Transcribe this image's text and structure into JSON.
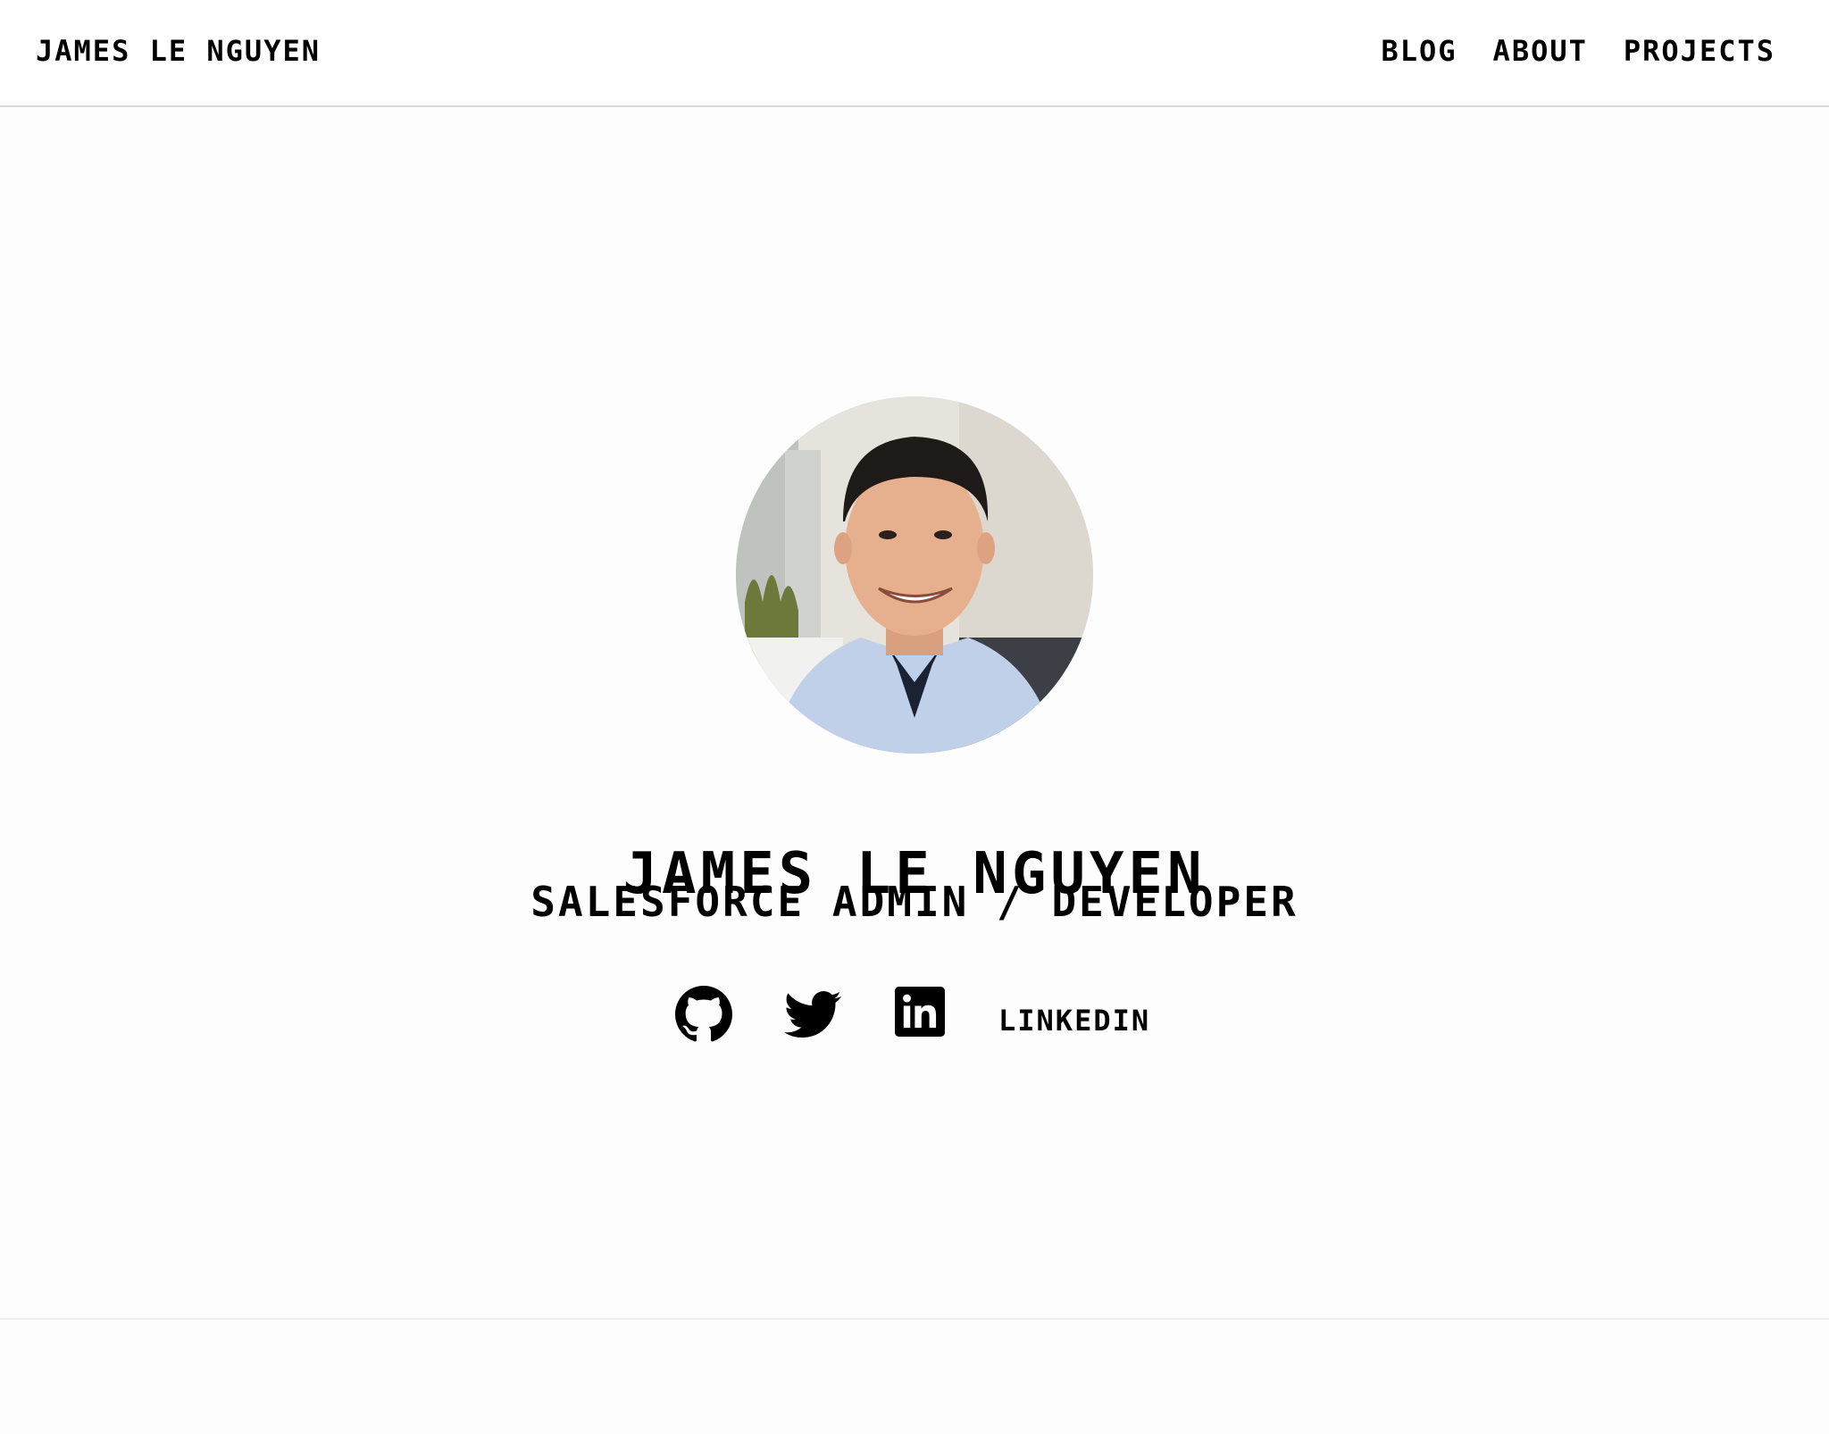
{
  "header": {
    "brand": "JAMES LE NGUYEN",
    "nav": [
      "BLOG",
      "ABOUT",
      "PROJECTS"
    ]
  },
  "profile": {
    "name": "JAMES LE NGUYEN",
    "role": "SALESFORCE ADMIN / DEVELOPER",
    "avatar_icon": "profile-photo"
  },
  "social": {
    "icons": [
      "github-icon",
      "twitter-icon",
      "linkedin-icon"
    ],
    "linkedin_label": "LINKEDIN"
  },
  "colors": {
    "text": "#000000",
    "background": "#fdfdfd",
    "divider": "#d9d9d9"
  }
}
